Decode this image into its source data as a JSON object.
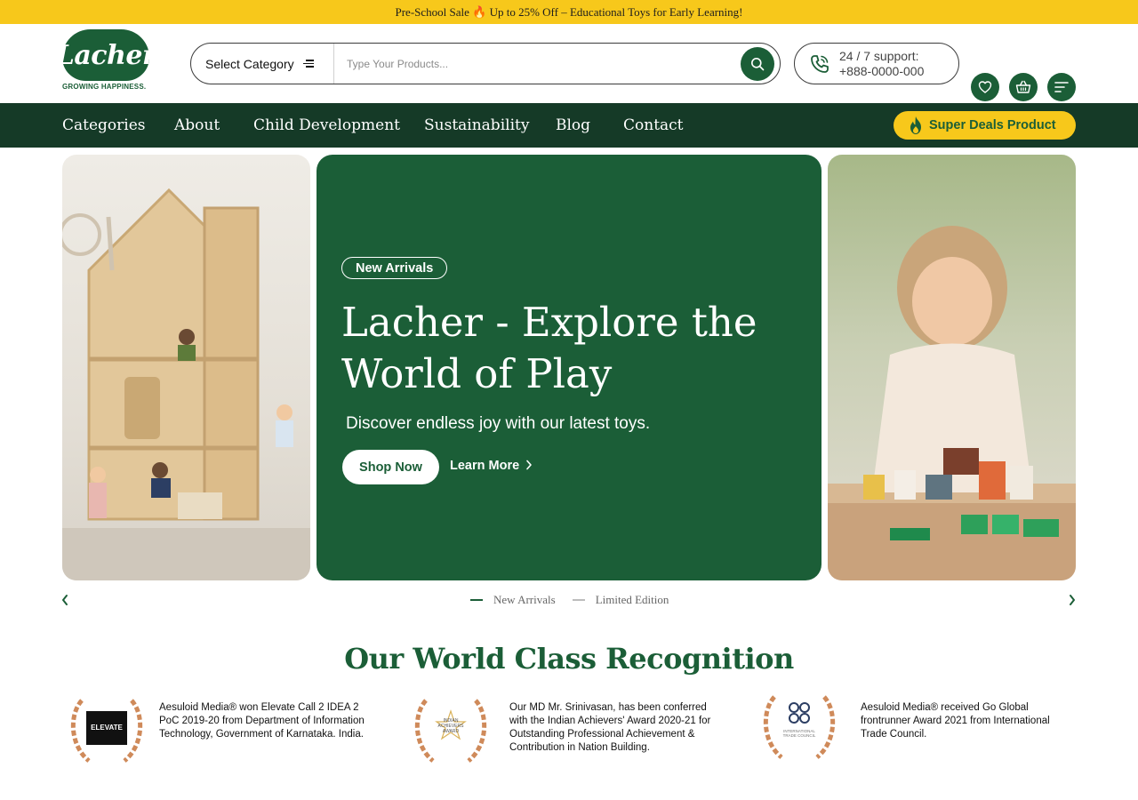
{
  "promo": {
    "text": "Pre-School Sale 🔥 Up to 25% Off – Educational Toys for Early Learning!"
  },
  "header": {
    "logo_text": "Lacher",
    "logo_tagline": "GROWING HAPPINESS.",
    "search": {
      "category_label": "Select Category",
      "placeholder": "Type Your Products..."
    },
    "support": {
      "line1": "24 / 7 support:",
      "line2": "+888-0000-000"
    }
  },
  "nav": {
    "items": [
      {
        "label": "Categories"
      },
      {
        "label": "About"
      },
      {
        "label": "Child Development"
      },
      {
        "label": "Sustainability"
      },
      {
        "label": "Blog"
      },
      {
        "label": "Contact"
      }
    ],
    "deals_label": "Super Deals Product"
  },
  "hero": {
    "badge": "New Arrivals",
    "title": "Lacher - Explore the World of Play",
    "subtitle": "Discover endless joy with our latest toys.",
    "primary_button": "Shop Now",
    "secondary_link": "Learn More"
  },
  "carousel": {
    "tabs": [
      {
        "label": "New Arrivals",
        "active": true
      },
      {
        "label": "Limited Edition",
        "active": false
      }
    ]
  },
  "recognition": {
    "title": "Our World Class Recognition",
    "awards": [
      {
        "emblem": "ELEVATE",
        "text": "Aesuloid Media® won Elevate Call 2 IDEA 2 PoC 2019-20 from Department of Information Technology, Government of Karnataka. India."
      },
      {
        "emblem": "INDIAN ACHIEVERS AWARD",
        "text": "Our MD Mr. Srinivasan, has been conferred with the Indian Achievers' Award 2020-21 for Outstanding Professional Achievement & Contribution in Nation Building."
      },
      {
        "emblem": "INTERNATIONAL TRADE COUNCIL",
        "text": "Aesuloid Media® received Go Global frontrunner Award 2021 from International Trade Council."
      }
    ]
  },
  "colors": {
    "brand_green": "#1b5e37",
    "nav_dark": "#153a27",
    "accent_yellow": "#f7c81b",
    "award_bronze": "#cf8a5a"
  }
}
